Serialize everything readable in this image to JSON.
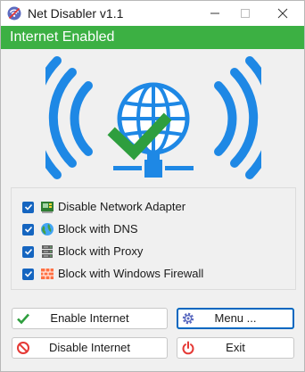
{
  "window": {
    "title": "Net Disabler v1.1",
    "controls": [
      "minimize-icon",
      "maximize-icon",
      "close-icon"
    ]
  },
  "status": {
    "text": "Internet Enabled",
    "color": "#3cb043"
  },
  "hero": {
    "icon": "wifi-globe-check-icon",
    "wave_color": "#1e88e5",
    "check_color": "#2e9e3e"
  },
  "options": [
    {
      "label": "Disable Network Adapter",
      "checked": true,
      "icon": "network-adapter-icon"
    },
    {
      "label": "Block with DNS",
      "checked": true,
      "icon": "globe-icon"
    },
    {
      "label": "Block with Proxy",
      "checked": true,
      "icon": "server-icon"
    },
    {
      "label": "Block with Windows Firewall",
      "checked": true,
      "icon": "firewall-icon"
    }
  ],
  "buttons": {
    "enable": {
      "label": "Enable Internet",
      "icon": "check-icon"
    },
    "menu": {
      "label": "Menu ...",
      "icon": "gear-icon"
    },
    "disable": {
      "label": "Disable Internet",
      "icon": "prohibited-icon"
    },
    "exit": {
      "label": "Exit",
      "icon": "power-icon"
    }
  }
}
